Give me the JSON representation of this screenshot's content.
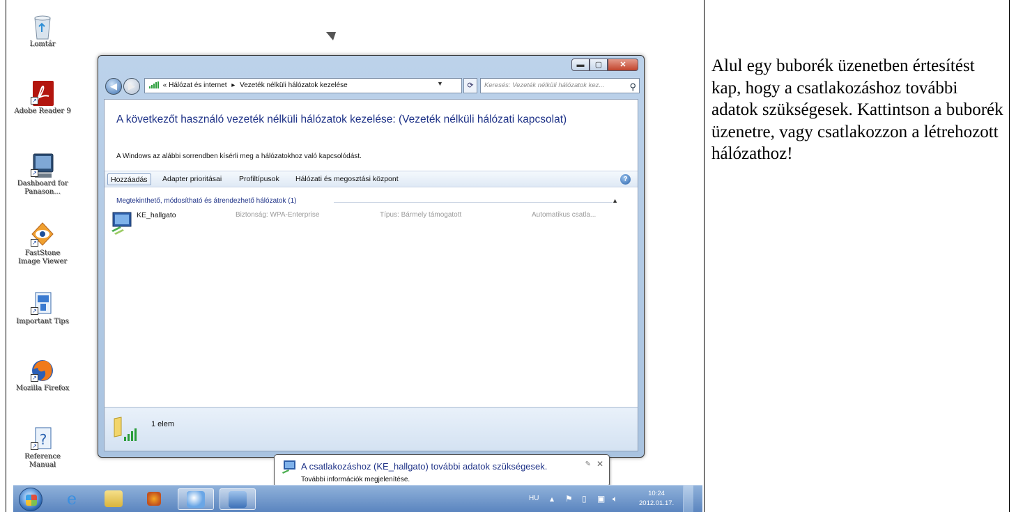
{
  "desktop": {
    "icons": [
      {
        "name": "recycle-bin",
        "label": "Lomtár"
      },
      {
        "name": "adobe-reader",
        "label": "Adobe Reader 9"
      },
      {
        "name": "dashboard",
        "label": "Dashboard for Panason..."
      },
      {
        "name": "faststone",
        "label": "FastStone Image Viewer"
      },
      {
        "name": "important-tips",
        "label": "Important Tips"
      },
      {
        "name": "mozilla-firefox",
        "label": "Mozilla Firefox"
      },
      {
        "name": "reference-manual",
        "label": "Reference Manual"
      }
    ]
  },
  "window": {
    "controls": {
      "minimize": "▬",
      "maximize": "▢",
      "close": "✕"
    },
    "address": {
      "prefix": "«",
      "crumb1": "Hálózat és internet",
      "separator": "▸",
      "crumb2": "Vezeték nélküli hálózatok kezelése"
    },
    "search_placeholder": "Keresés: Vezeték nélküli hálózatok kez...",
    "title": "A következőt használó vezeték nélküli hálózatok kezelése: (Vezeték nélküli hálózati kapcsolat)",
    "description": "A Windows az alábbi sorrendben kísérli meg a hálózatokhoz való kapcsolódást.",
    "toolbar": {
      "add": "Hozzáadás",
      "adapter": "Adapter prioritásai",
      "profile_types": "Profiltípusok",
      "sharing_center": "Hálózati és megosztási központ"
    },
    "group_header": "Megtekinthető, módosítható és átrendezhető hálózatok (1)",
    "networks": [
      {
        "name": "KE_hallgato",
        "security": "Biztonság: WPA-Enterprise",
        "type": "Típus: Bármely támogatott",
        "mode": "Automatikus csatla..."
      }
    ],
    "details": {
      "count": "1 elem"
    }
  },
  "notification": {
    "title": "A csatlakozáshoz (KE_hallgato) további adatok szükségesek.",
    "subtitle": "További információk megjelenítése."
  },
  "taskbar": {
    "language": "HU",
    "time": "10:24",
    "date": "2012.01.17."
  },
  "instruction": {
    "text": "Alul egy buborék üzenetben értesítést kap, hogy a csatlakozáshoz további adatok szükségesek. Kattintson a buborék üzenetre, vagy csatlakozzon a létrehozott hálózathoz!"
  },
  "colors": {
    "link_blue": "#1e3287",
    "taskbar": "#5b85bf"
  }
}
